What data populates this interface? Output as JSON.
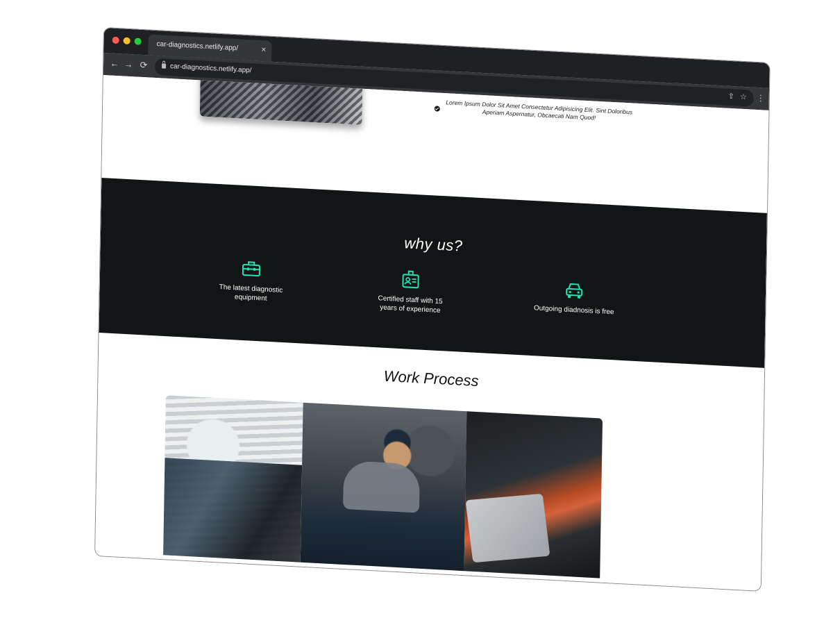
{
  "browser": {
    "tab_title": "car-diagnostics.netlify.app/",
    "tab_close": "×",
    "url": "car-diagnostics.netlify.app/",
    "nav": {
      "back": "←",
      "forward": "→",
      "reload": "⟳"
    },
    "actions": {
      "share": "⇪",
      "bookmark": "☆",
      "menu": "⋮"
    },
    "colors": {
      "frame": "#1f2023",
      "toolbar": "#35363a",
      "omnibox": "#202124"
    }
  },
  "about": {
    "bullet_text": "Lorem Ipsum Dolor Sit Amet Consectetur Adipisicing Elit. Sint Doloribus Aperiam Aspernatur, Obcaecati Nam Quod!",
    "bullet_icon": "check-circle-icon"
  },
  "why_us": {
    "title": "why us?",
    "background": "#111516",
    "accent": "#1ee3b4",
    "features": [
      {
        "icon": "toolbox-icon",
        "label": "The latest diagnostic equipment"
      },
      {
        "icon": "id-badge-icon",
        "label": "Certified staff with 15 years of experience"
      },
      {
        "icon": "car-icon",
        "label": "Outgoing diadnosis is free"
      }
    ]
  },
  "work_process": {
    "title": "Work Process",
    "photos": [
      {
        "subject": "mechanic working under car hood"
      },
      {
        "subject": "mechanic holding wrench"
      },
      {
        "subject": "laptop diagnostics on engine"
      }
    ]
  }
}
